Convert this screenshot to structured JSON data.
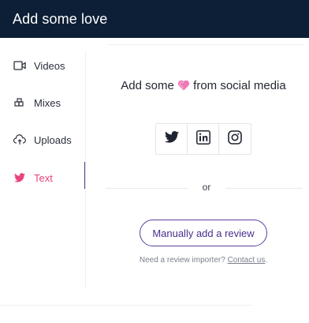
{
  "header": {
    "title": "Add some love"
  },
  "sidebar": {
    "items": [
      {
        "label": "Videos",
        "icon": "video-icon",
        "active": false
      },
      {
        "label": "Mixes",
        "icon": "mixes-icon",
        "active": false
      },
      {
        "label": "Uploads",
        "icon": "upload-cloud-icon",
        "active": false
      },
      {
        "label": "Text",
        "icon": "twitter-icon",
        "active": true
      }
    ]
  },
  "main": {
    "headline_before": "Add some",
    "headline_after": "from social media",
    "heart_icon": "heart-icon",
    "social": [
      {
        "name": "Twitter",
        "icon": "twitter-icon"
      },
      {
        "name": "LinkedIn",
        "icon": "linkedin-icon"
      },
      {
        "name": "Instagram",
        "icon": "instagram-icon"
      }
    ],
    "or_text": "or",
    "manual_button": "Manually add a review",
    "importer_text": "Need a review importer?",
    "importer_link": "Contact us",
    "importer_end": "."
  },
  "colors": {
    "header_bg": "#0d1f36",
    "accent_pink": "#e8447f",
    "accent_purple": "#4a2f8f"
  }
}
